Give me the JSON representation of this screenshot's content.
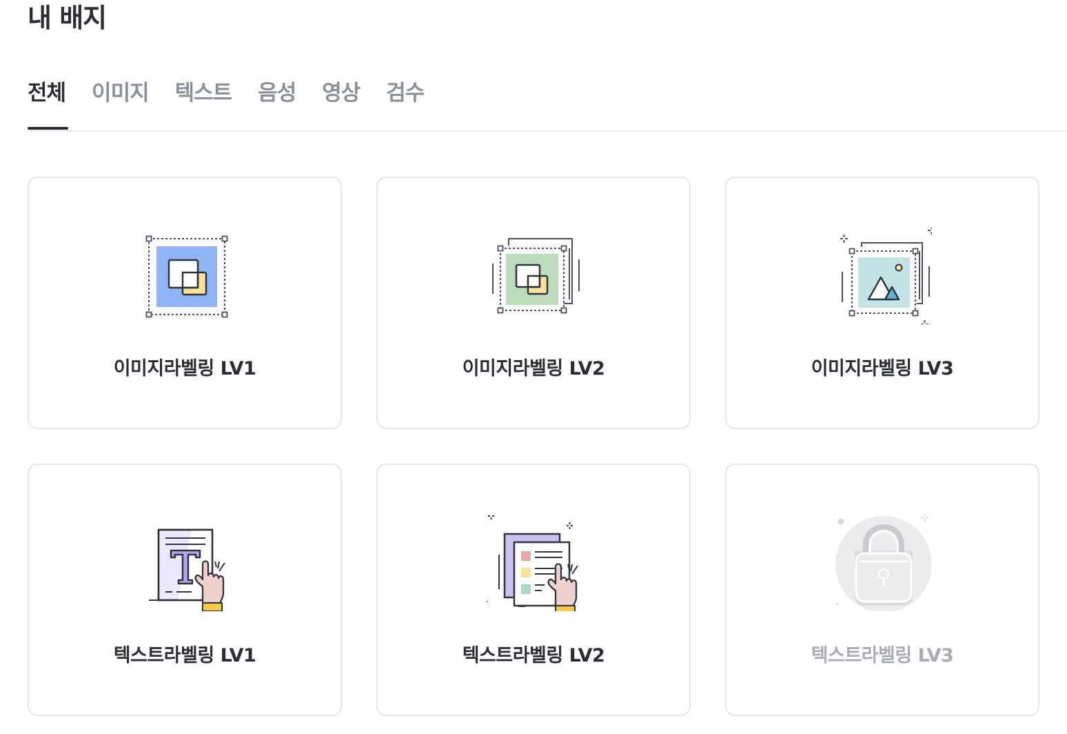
{
  "page": {
    "title": "내 배지"
  },
  "tabs": [
    {
      "label": "전체",
      "active": true
    },
    {
      "label": "이미지",
      "active": false
    },
    {
      "label": "텍스트",
      "active": false
    },
    {
      "label": "음성",
      "active": false
    },
    {
      "label": "영상",
      "active": false
    },
    {
      "label": "검수",
      "active": false
    }
  ],
  "badges": [
    {
      "label": "이미지라벨링 LV1",
      "icon": "image-labeling-lv1-icon",
      "locked": false
    },
    {
      "label": "이미지라벨링 LV2",
      "icon": "image-labeling-lv2-icon",
      "locked": false
    },
    {
      "label": "이미지라벨링 LV3",
      "icon": "image-labeling-lv3-icon",
      "locked": false
    },
    {
      "label": "텍스트라벨링 LV1",
      "icon": "text-labeling-lv1-icon",
      "locked": false
    },
    {
      "label": "텍스트라벨링 LV2",
      "icon": "text-labeling-lv2-icon",
      "locked": false
    },
    {
      "label": "텍스트라벨링 LV3",
      "icon": "lock-icon",
      "locked": true
    }
  ],
  "colors": {
    "active_tab": "#2a2d33",
    "inactive_tab": "#8a9099",
    "card_border": "#e4e5e8",
    "locked_text": "#a8acb2",
    "blue_fill": "#8fb4f5",
    "green_fill": "#bcdcbc",
    "teal_fill": "#c4e3e6",
    "yellow_fill": "#fbe29a",
    "lavender_fill": "#c8bff2",
    "pink_fill": "#efd2cc"
  }
}
